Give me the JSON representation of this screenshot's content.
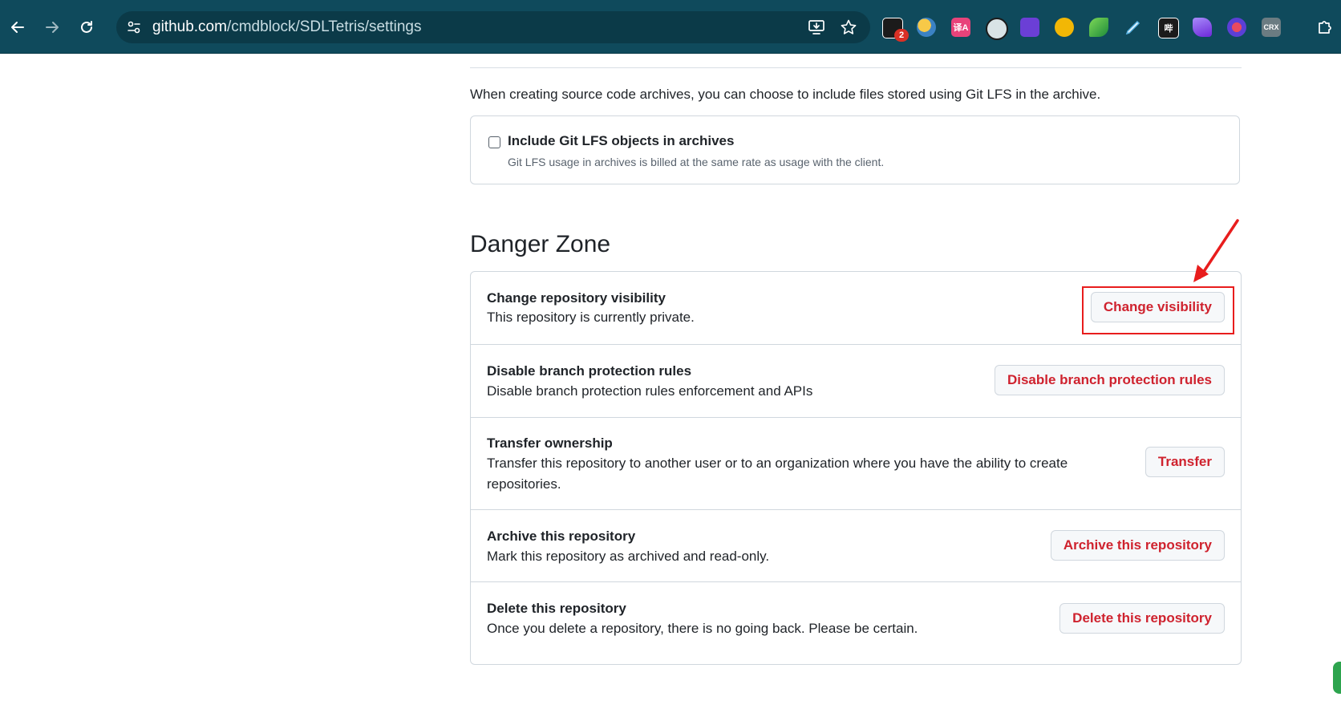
{
  "browser": {
    "url_host": "github.com",
    "url_path": "/cmdblock/SDLTetris/settings",
    "extension_badge": "2",
    "extensions": [
      "ext-mail-icon",
      "ext-ball-icon",
      "ext-translate-icon",
      "ext-circle-icon",
      "ext-purple-icon",
      "ext-yellow-icon",
      "ext-leaf-icon",
      "ext-pen-icon",
      "ext-dark-icon",
      "ext-crystal-icon",
      "ext-globe-icon",
      "ext-crx-icon",
      "ext-puzzle-icon"
    ],
    "crx_label": "CRX",
    "dark_ext_label": "哔",
    "translate_label": "译A"
  },
  "lfs": {
    "description": "When creating source code archives, you can choose to include files stored using Git LFS in the archive.",
    "checkbox_label": "Include Git LFS objects in archives",
    "checkbox_note": "Git LFS usage in archives is billed at the same rate as usage with the client.",
    "checked": false
  },
  "danger_zone": {
    "title": "Danger Zone",
    "rows": [
      {
        "title": "Change repository visibility",
        "description": "This repository is currently private.",
        "button": "Change visibility"
      },
      {
        "title": "Disable branch protection rules",
        "description": "Disable branch protection rules enforcement and APIs",
        "button": "Disable branch protection rules"
      },
      {
        "title": "Transfer ownership",
        "description": "Transfer this repository to another user or to an organization where you have the ability to create repositories.",
        "button": "Transfer"
      },
      {
        "title": "Archive this repository",
        "description": "Mark this repository as archived and read-only.",
        "button": "Archive this repository"
      },
      {
        "title": "Delete this repository",
        "description": "Once you delete a repository, there is no going back. Please be certain.",
        "button": "Delete this repository"
      }
    ]
  },
  "colors": {
    "chrome": "#0f4a5c",
    "danger_text": "#cf222e",
    "annotation_red": "#e81d1d"
  }
}
